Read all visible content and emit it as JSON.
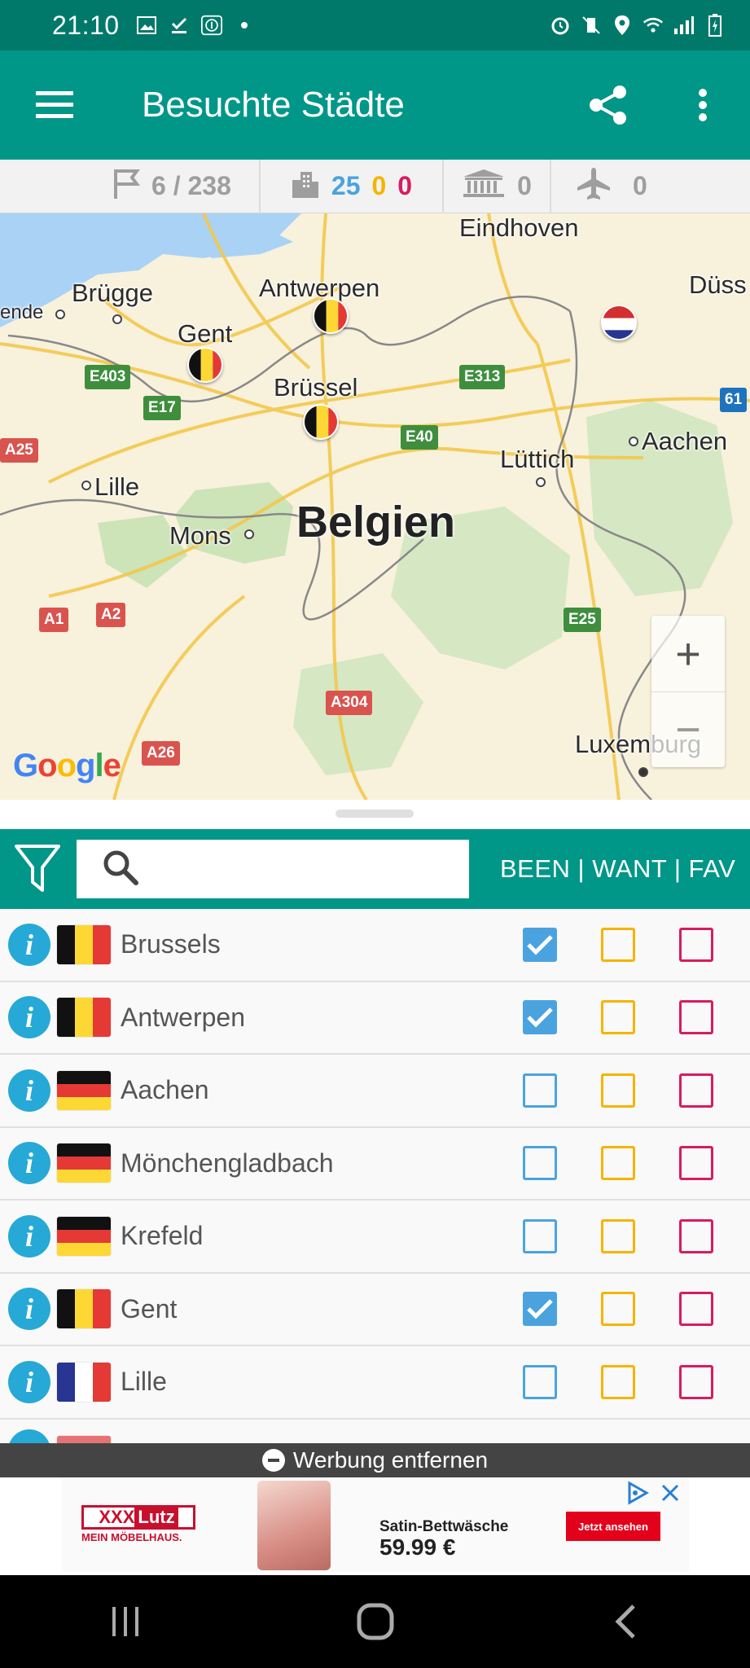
{
  "status_bar": {
    "time": "21:10"
  },
  "app_bar": {
    "title": "Besuchte Städte"
  },
  "stats": {
    "cities_progress": "6 / 238",
    "been_count": "25",
    "want_count": "0",
    "fav_count": "0",
    "unesco_count": "0",
    "airports_count": "0"
  },
  "map": {
    "country_label": "Belgien",
    "city_labels": [
      "Eindhoven",
      "Düss",
      "Antwerpen",
      "Brügge",
      "ende",
      "Gent",
      "Brüssel",
      "Aachen",
      "Lüttich",
      "Lille",
      "Mons",
      "Luxemburg"
    ],
    "roads": [
      "E403",
      "E17",
      "A25",
      "E313",
      "E40",
      "61",
      "A1",
      "A2",
      "A304",
      "E25",
      "A26"
    ],
    "zoom_in": "+",
    "zoom_out": "−",
    "attribution": "Google"
  },
  "search": {
    "placeholder": "",
    "value": ""
  },
  "list_header": {
    "columns_label": "BEEN | WANT | FAV"
  },
  "cities": [
    {
      "name": "Brussels",
      "country": "belgium",
      "been": true,
      "want": false,
      "fav": false
    },
    {
      "name": "Antwerpen",
      "country": "belgium",
      "been": true,
      "want": false,
      "fav": false
    },
    {
      "name": "Aachen",
      "country": "germany",
      "been": false,
      "want": false,
      "fav": false
    },
    {
      "name": "Mönchengladbach",
      "country": "germany",
      "been": false,
      "want": false,
      "fav": false
    },
    {
      "name": "Krefeld",
      "country": "germany",
      "been": false,
      "want": false,
      "fav": false
    },
    {
      "name": "Gent",
      "country": "belgium",
      "been": true,
      "want": false,
      "fav": false
    },
    {
      "name": "Lille",
      "country": "france",
      "been": false,
      "want": false,
      "fav": false
    }
  ],
  "ad": {
    "remove_label": "Werbung entfernen",
    "brand_main": "XXX",
    "brand_accent": "Lutz",
    "brand_tagline": "MEIN MÖBELHAUS.",
    "product": "Satin-Bettwäsche",
    "price": "59.99 €",
    "cta": "Jetzt ansehen"
  },
  "colors": {
    "primary": "#009688",
    "primary_dark": "#00796b",
    "been": "#4aa3df",
    "want": "#f5b400",
    "fav": "#d81b60",
    "info": "#26a9d6"
  },
  "icons": {
    "menu": "hamburger-icon",
    "share": "share-icon",
    "more": "more-vert-icon",
    "flag": "flag-icon",
    "city": "buildings-icon",
    "unesco": "unesco-icon",
    "airport": "plane-icon",
    "filter": "filter-icon",
    "search": "search-icon"
  }
}
